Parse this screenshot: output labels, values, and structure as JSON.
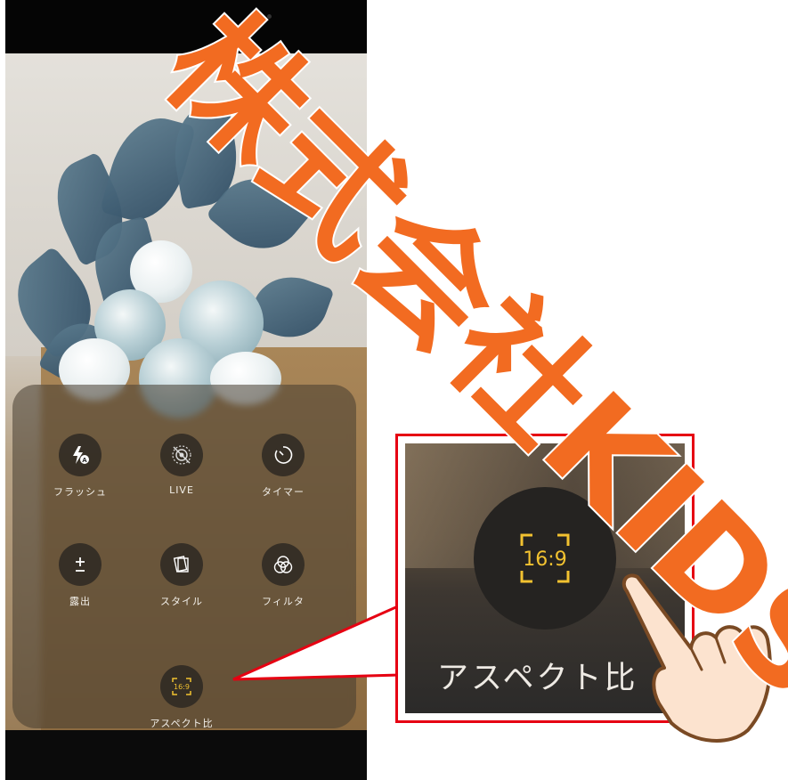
{
  "camera_quick_settings": {
    "items": [
      {
        "label": "フラッシュ",
        "icon": "flash-auto-icon"
      },
      {
        "label": "LIVE",
        "icon": "live-photo-off-icon"
      },
      {
        "label": "タイマー",
        "icon": "timer-icon"
      },
      {
        "label": "露出",
        "icon": "exposure-icon"
      },
      {
        "label": "スタイル",
        "icon": "style-icon"
      },
      {
        "label": "フィルタ",
        "icon": "filter-icon"
      },
      {
        "label": "アスペクト比",
        "icon": "aspect-ratio-icon"
      }
    ],
    "aspect_ratio_value": "16:9"
  },
  "zoom_callout": {
    "label": "アスペクト比",
    "value": "16:9",
    "border_color": "#e60012"
  },
  "watermark": {
    "text": "株式会社KIDS",
    "color": "#f26b21"
  },
  "colors": {
    "accent_yellow": "#f2c230",
    "callout_red": "#e60012"
  }
}
